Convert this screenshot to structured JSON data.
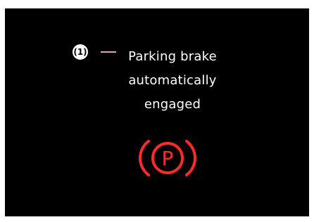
{
  "callout": {
    "number": "(1)"
  },
  "message": {
    "line1": "Parking brake",
    "line2": "automatically",
    "line3": "engaged"
  },
  "indicator": {
    "symbol": "P",
    "icon": "parking-brake-icon",
    "color": "#ff2a2a"
  },
  "colors": {
    "background": "#000000",
    "text": "#ffffff",
    "leader": "#d9a6b5"
  }
}
